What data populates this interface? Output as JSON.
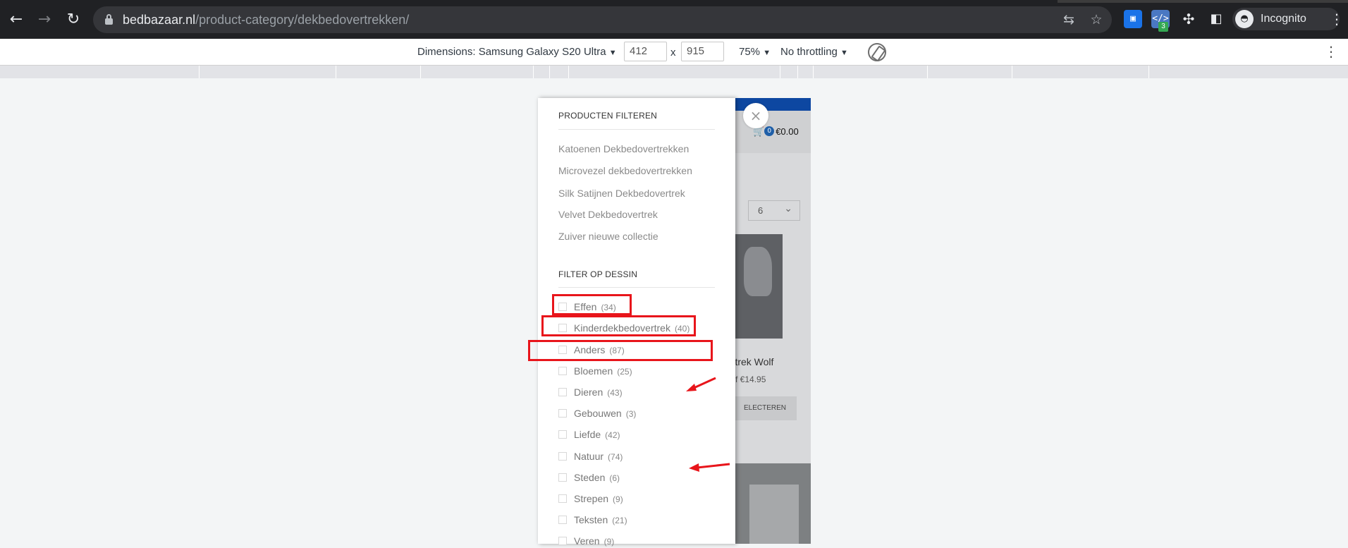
{
  "browser": {
    "url_host": "bedbazaar.nl",
    "url_path": "/product-category/dekbedovertrekken/",
    "incognito_label": "Incognito",
    "extension_badge": "3",
    "icons": [
      "back-arrow-icon",
      "forward-arrow-icon",
      "reload-icon",
      "lock-icon",
      "translate-icon",
      "star-icon",
      "puzzle-icon",
      "side-panel-icon",
      "incognito-icon",
      "kebab-menu-icon"
    ]
  },
  "device_toolbar": {
    "dimensions_label": "Dimensions: Samsung Galaxy S20 Ultra",
    "width": "412",
    "times": "x",
    "height": "915",
    "zoom": "75%",
    "throttling": "No throttling"
  },
  "page": {
    "cart_count": "0",
    "cart_total": "€0.00",
    "per_page_value": "6",
    "product_title": "vertrek Wolf",
    "product_price": "f €14.95",
    "select_button": "ELECTEREN"
  },
  "filter_panel": {
    "categories_title": "PRODUCTEN FILTEREN",
    "categories": [
      "Katoenen Dekbedovertrekken",
      "Microvezel dekbedovertrekken",
      "Silk Satijnen Dekbedovertrek",
      "Velvet Dekbedovertrek",
      "Zuiver nieuwe collectie"
    ],
    "pattern_title": "FILTER OP DESSIN",
    "patterns": [
      {
        "label": "Effen",
        "count": "(34)"
      },
      {
        "label": "Kinderdekbedovertrek",
        "count": "(40)"
      },
      {
        "label": "Anders",
        "count": "(87)"
      },
      {
        "label": "Bloemen",
        "count": "(25)"
      },
      {
        "label": "Dieren",
        "count": "(43)"
      },
      {
        "label": "Gebouwen",
        "count": "(3)"
      },
      {
        "label": "Liefde",
        "count": "(42)"
      },
      {
        "label": "Natuur",
        "count": "(74)"
      },
      {
        "label": "Steden",
        "count": "(6)"
      },
      {
        "label": "Strepen",
        "count": "(9)"
      },
      {
        "label": "Teksten",
        "count": "(21)"
      },
      {
        "label": "Veren",
        "count": "(9)"
      }
    ]
  },
  "colors": {
    "annotation_red": "#e8151b",
    "browser_dark": "#202124",
    "header_blue": "#0d47a1"
  }
}
